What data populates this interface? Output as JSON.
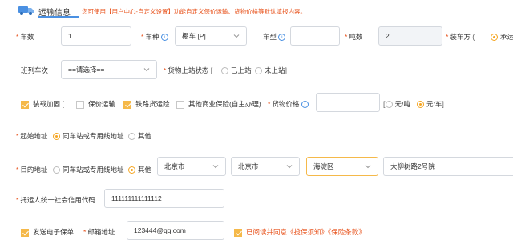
{
  "header": {
    "title": "运输信息",
    "note": "您可使用【用户中心-自定义设置】功能自定义保价运输、货物价格等默认填报内容。"
  },
  "row1": {
    "carcount_label": "车数",
    "carcount_value": "1",
    "cartype_label": "车种",
    "cartype_value": "棚车 [P]",
    "model_label": "车型",
    "model_value": "",
    "tonnage_label": "吨数",
    "tonnage_value": "2",
    "loading_label": "装车方",
    "loading_option": "承运人"
  },
  "row2": {
    "train_label": "班列车次",
    "train_value": "==请选择==",
    "onstation_label": "货物上站状态",
    "opt_on": "已上站",
    "opt_off": "未上站"
  },
  "row3": {
    "reinforce": "装载加固",
    "insured": "保价运输",
    "railgoods": "铁路货运险",
    "otherins": "其他商业保险(自主办理)",
    "price_label": "货物价格",
    "price_value": "",
    "unit_ton": "元/吨",
    "unit_car": "元/车"
  },
  "row4": {
    "origin_label": "起始地址",
    "opt_station": "同车站或专用线地址",
    "opt_other": "其他"
  },
  "row5": {
    "dest_label": "目的地址",
    "opt_station": "同车站或专用线地址",
    "opt_other": "其他",
    "province": "北京市",
    "city": "北京市",
    "district": "海淀区",
    "street": "大柳树路2号院"
  },
  "row6": {
    "credit_label": "托运人统一社会信用代码",
    "credit_value": "111111111111112"
  },
  "row7": {
    "ereceipt": "发送电子保单",
    "email_label": "邮箱地址",
    "email_value": "123444@qq.com",
    "agree_prefix": "已阅读并同意",
    "agree_notice": "《投保须知》",
    "agree_terms": "《保险条款》"
  },
  "colors": {
    "accent": "#4a90e2",
    "warning": "#e8541e",
    "checkbox": "#f5b94a",
    "radio": "#f5a623"
  }
}
